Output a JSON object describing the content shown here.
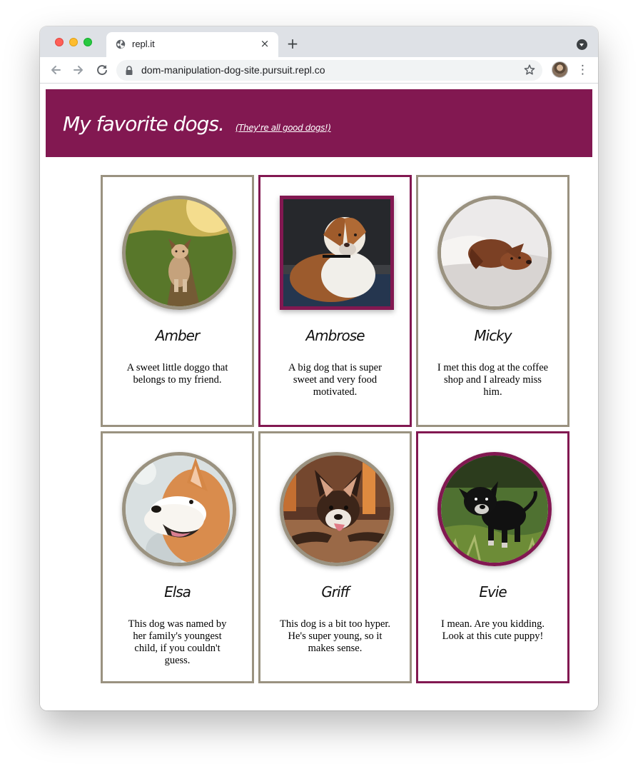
{
  "browser": {
    "tab_title": "repl.it",
    "tab_close_label": "×",
    "new_tab_label": "+",
    "url": "dom-manipulation-dog-site.pursuit.repl.co",
    "menu_label": "⋮",
    "icons": {
      "back": "back-arrow-icon",
      "forward": "forward-arrow-icon",
      "reload": "reload-icon",
      "lock": "lock-icon",
      "bookmark": "star-icon",
      "tab_favicon": "globe-icon"
    }
  },
  "page": {
    "title": "My favorite dogs.",
    "subtitle": "(They're all good dogs!)",
    "colors": {
      "header_background": "#821851",
      "card_border": "#9a9280",
      "featured_border": "#821851"
    }
  },
  "dogs": [
    {
      "name": "Amber",
      "description": "A sweet little doggo that belongs to my friend.",
      "photo_icon": "dog-photo-amber",
      "photo_shape": "circle",
      "featured": false
    },
    {
      "name": "Ambrose",
      "description": "A big dog that is super sweet and very food motivated.",
      "photo_icon": "dog-photo-ambrose",
      "photo_shape": "square",
      "featured": true
    },
    {
      "name": "Micky",
      "description": "I met this dog at the coffee shop and I already miss him.",
      "photo_icon": "dog-photo-micky",
      "photo_shape": "circle",
      "featured": false
    },
    {
      "name": "Elsa",
      "description": "This dog was named by her family's youngest child, if you couldn't guess.",
      "photo_icon": "dog-photo-elsa",
      "photo_shape": "circle",
      "featured": false
    },
    {
      "name": "Griff",
      "description": "This dog is a bit too hyper. He's super young, so it makes sense.",
      "photo_icon": "dog-photo-griff",
      "photo_shape": "circle",
      "featured": false
    },
    {
      "name": "Evie",
      "description": "I mean. Are you kidding. Look at this cute puppy!",
      "photo_icon": "dog-photo-evie",
      "photo_shape": "circle",
      "featured": true
    }
  ]
}
